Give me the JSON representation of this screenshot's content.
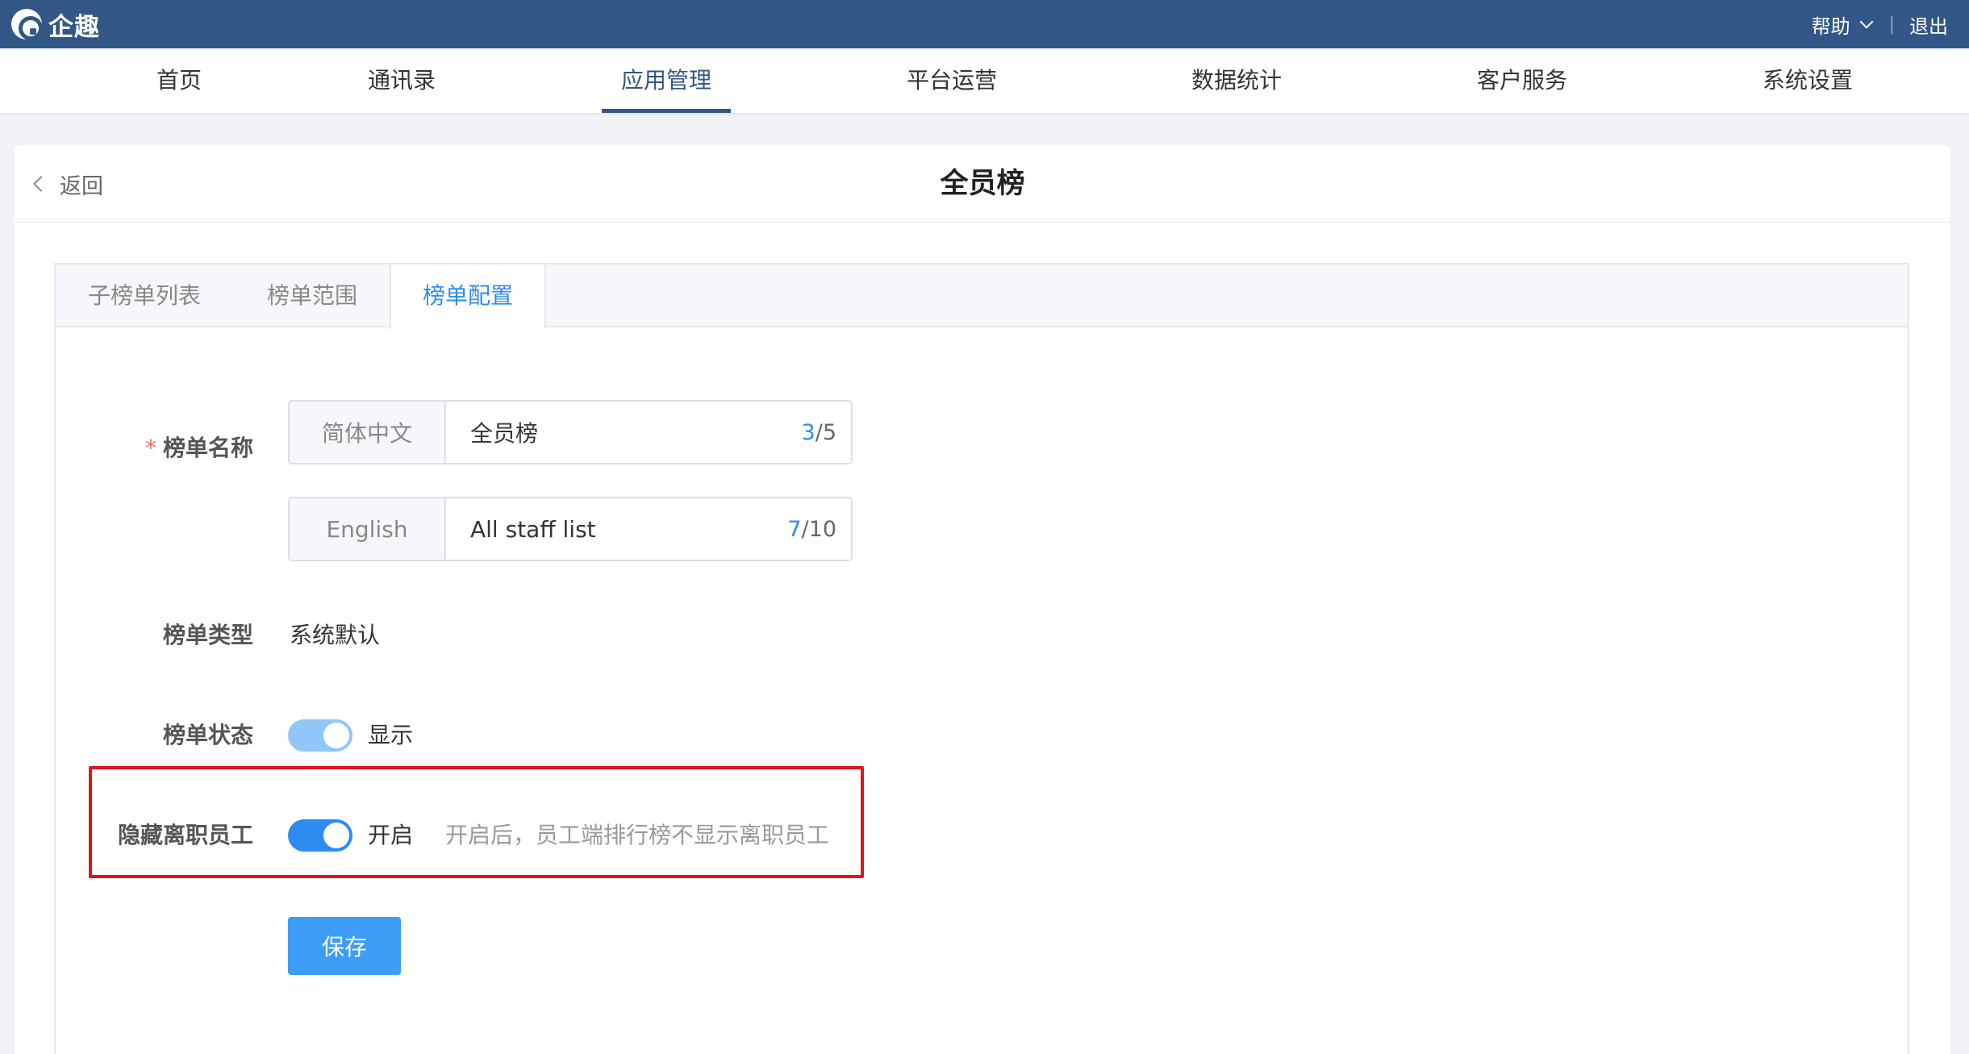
{
  "header": {
    "brand": "企趣",
    "help_label": "帮助",
    "separator": "|",
    "logout_label": "退出"
  },
  "nav": {
    "items": [
      {
        "label": "首页"
      },
      {
        "label": "通讯录"
      },
      {
        "label": "应用管理",
        "active": true
      },
      {
        "label": "平台运营"
      },
      {
        "label": "数据统计"
      },
      {
        "label": "客户服务"
      },
      {
        "label": "系统设置"
      }
    ]
  },
  "page": {
    "back_label": "返回",
    "title": "全员榜"
  },
  "tabs": [
    {
      "label": "子榜单列表"
    },
    {
      "label": "榜单范围"
    },
    {
      "label": "榜单配置",
      "active": true
    }
  ],
  "form": {
    "name": {
      "required_mark": "*",
      "label": "榜单名称",
      "zh": {
        "addon": "简体中文",
        "value": "全员榜",
        "count_current": "3",
        "count_max": "/5"
      },
      "en": {
        "addon": "English",
        "value": "All staff list",
        "count_current": "7",
        "count_max": "/10"
      }
    },
    "type": {
      "label": "榜单类型",
      "value": "系统默认"
    },
    "status": {
      "label": "榜单状态",
      "toggle_text": "显示",
      "enabled": true
    },
    "hide_resigned": {
      "label": "隐藏离职员工",
      "toggle_text": "开启",
      "hint": "开启后，员工端排行榜不显示离职员工",
      "enabled": true
    },
    "save_label": "保存"
  },
  "colors": {
    "topbar": "#325685",
    "accent": "#2d8cf0",
    "highlight_box": "#e0141b"
  }
}
